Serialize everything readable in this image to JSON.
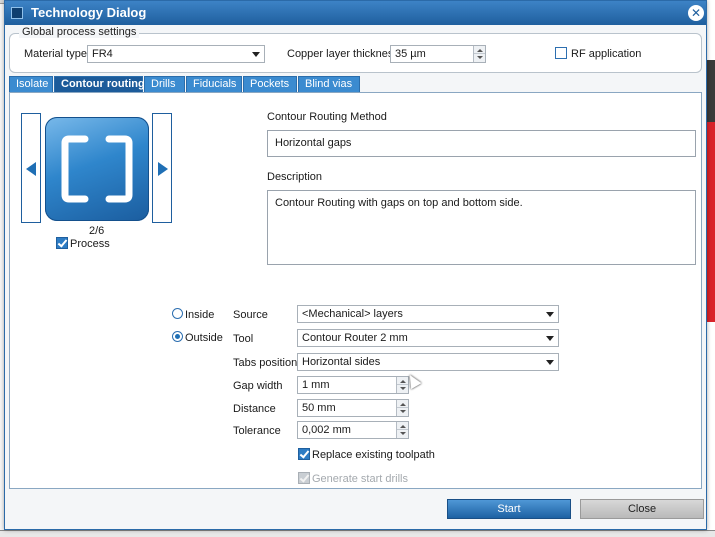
{
  "window": {
    "title": "Technology Dialog",
    "close_icon": "close-icon",
    "accent": "#1f5f9e"
  },
  "global": {
    "group_label": "Global process settings",
    "material_label": "Material type",
    "material_value": "FR4",
    "copper_label": "Copper layer thickness",
    "copper_value": "35 µm",
    "rf_label": "RF application",
    "rf_checked": false
  },
  "tabs": [
    {
      "label": "Isolate",
      "active": false
    },
    {
      "label": "Contour routing",
      "active": true
    },
    {
      "label": "Drills",
      "active": false
    },
    {
      "label": "Fiducials",
      "active": false
    },
    {
      "label": "Pockets",
      "active": false
    },
    {
      "label": "Blind vias",
      "active": false
    }
  ],
  "selector": {
    "counter": "2/6",
    "process_label": "Process",
    "process_checked": true
  },
  "method": {
    "label": "Contour Routing Method",
    "value": "Horizontal gaps",
    "description_label": "Description",
    "description": "Contour Routing with gaps on top and bottom side."
  },
  "options": {
    "inside_label": "Inside",
    "outside_label": "Outside",
    "selected": "Outside",
    "source_label": "Source",
    "source_value": "<Mechanical> layers",
    "tool_label": "Tool",
    "tool_value": "Contour Router 2 mm",
    "tabs_position_label": "Tabs position",
    "tabs_position_value": "Horizontal sides",
    "gap_width_label": "Gap width",
    "gap_width_value": "1 mm",
    "distance_label": "Distance",
    "distance_value": "50 mm",
    "tolerance_label": "Tolerance",
    "tolerance_value": "0,002 mm",
    "replace_label": "Replace existing toolpath",
    "replace_checked": true,
    "generate_label": "Generate start drills",
    "generate_checked": true,
    "generate_disabled": true
  },
  "buttons": {
    "start": "Start",
    "close": "Close"
  }
}
